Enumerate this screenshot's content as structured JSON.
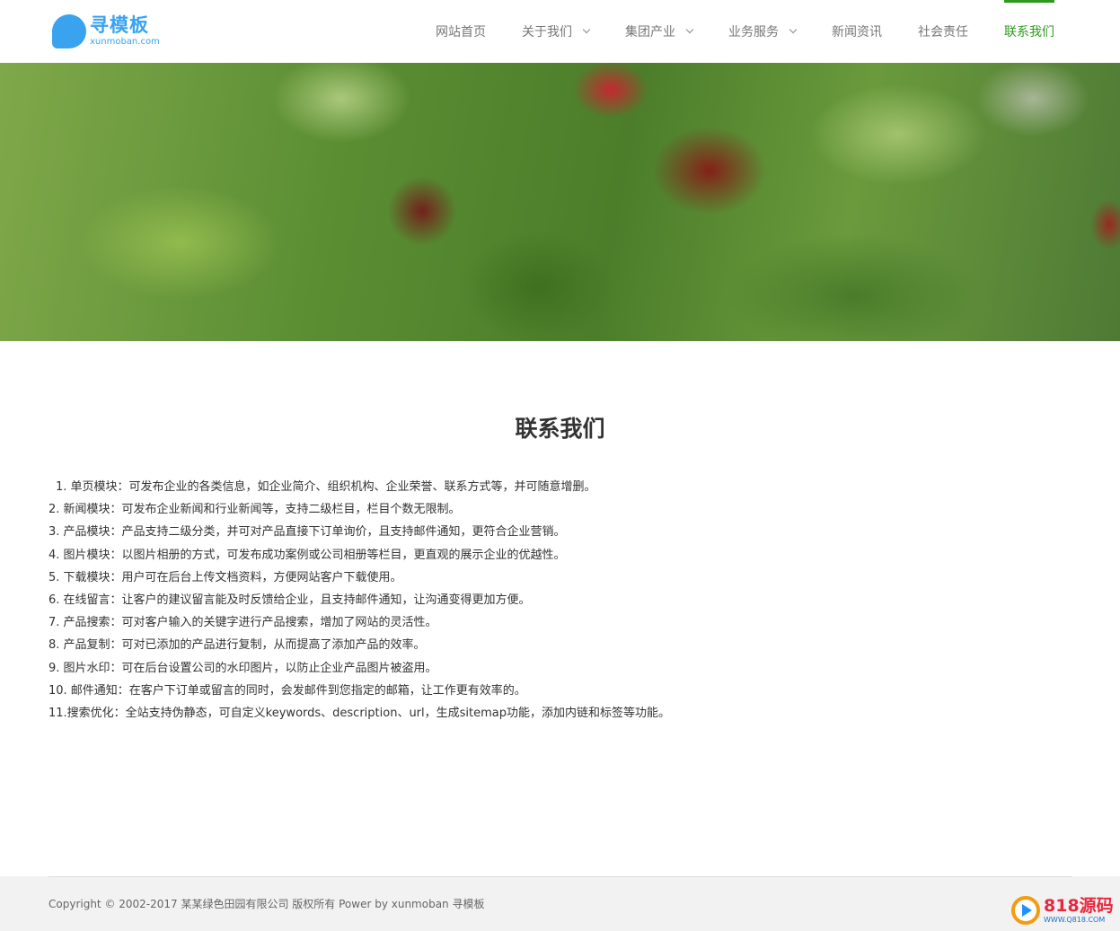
{
  "header": {
    "logo": {
      "name": "寻模板",
      "domain": "xunmoban.com"
    },
    "nav": [
      {
        "label": "网站首页",
        "dropdown": false,
        "active": false
      },
      {
        "label": "关于我们",
        "dropdown": true,
        "active": false
      },
      {
        "label": "集团产业",
        "dropdown": true,
        "active": false
      },
      {
        "label": "业务服务",
        "dropdown": true,
        "active": false
      },
      {
        "label": "新闻资讯",
        "dropdown": false,
        "active": false
      },
      {
        "label": "社会责任",
        "dropdown": false,
        "active": false
      },
      {
        "label": "联系我们",
        "dropdown": false,
        "active": true
      }
    ]
  },
  "colors": {
    "accent": "#2e9a1d",
    "logo": "#3aa3f0"
  },
  "content": {
    "title": "联系我们",
    "items": [
      "1. 单页模块：可发布企业的各类信息，如企业简介、组织机构、企业荣誉、联系方式等，并可随意增删。",
      "2. 新闻模块：可发布企业新闻和行业新闻等，支持二级栏目，栏目个数无限制。",
      "3. 产品模块：产品支持二级分类，并可对产品直接下订单询价，且支持邮件通知，更符合企业营销。",
      "4. 图片模块：以图片相册的方式，可发布成功案例或公司相册等栏目，更直观的展示企业的优越性。",
      "5. 下载模块：用户可在后台上传文档资料，方便网站客户下载使用。",
      "6. 在线留言：让客户的建议留言能及时反馈给企业，且支持邮件通知，让沟通变得更加方便。",
      "7. 产品搜索：可对客户输入的关键字进行产品搜索，增加了网站的灵活性。",
      "8. 产品复制：可对已添加的产品进行复制，从而提高了添加产品的效率。",
      "9. 图片水印：可在后台设置公司的水印图片，以防止企业产品图片被盗用。",
      "10. 邮件通知：在客户下订单或留言的同时，会发邮件到您指定的邮箱，让工作更有效率的。",
      "11.搜索优化：全站支持伪静态，可自定义keywords、description、url，生成sitemap功能，添加内链和标签等功能。"
    ]
  },
  "footer": {
    "copyright": "Copyright © 2002-2017 某某绿色田园有限公司 版权所有 Power by xunmoban 寻模板"
  },
  "watermark": {
    "main": "818源码",
    "sub": "WWW.Q818.COM"
  }
}
